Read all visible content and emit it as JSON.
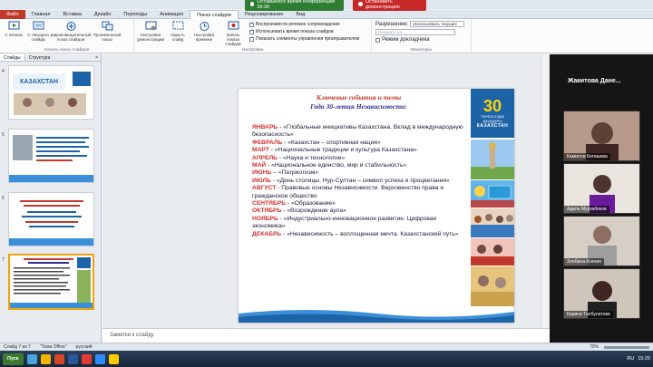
{
  "conference": {
    "time_label": "Оставшееся время конференции: 36:36",
    "stop_label": "Остановить демонстрацию"
  },
  "tabs": [
    "Файл",
    "Главная",
    "Вставка",
    "Дизайн",
    "Переходы",
    "Анимация",
    "Показ слайдов",
    "Рецензирование",
    "Вид"
  ],
  "ribbon": {
    "group1": {
      "label": "Начать показ слайдов",
      "buttons": [
        "С начала",
        "С текущего слайда",
        "Широковещательный показ слайдов",
        "Произвольный показ"
      ]
    },
    "group2": {
      "label": "Настройка",
      "buttons": [
        "Настройка демонстрации",
        "Скрыть слайд",
        "Настройка времени",
        "Запись показа слайдов"
      ],
      "checkboxes": [
        "Воспроизвести речевое сопровождение",
        "Использовать время показа слайдов",
        "Показать элементы управления проигрывателем"
      ]
    },
    "group3": {
      "label": "Мониторы",
      "resolution_label": "Разрешение:",
      "resolution_value": "Использовать текущее",
      "show_on_label": "Показать на:",
      "presenter_label": "Режим докладчика"
    }
  },
  "left_panel": {
    "tabs": [
      "Слайды",
      "Структура"
    ],
    "close": "×",
    "slide_numbers": [
      "4",
      "5",
      "6",
      "7"
    ]
  },
  "slide": {
    "title_line1": "Ключевые события и темы",
    "title_line2": "Года 30-летия Независимости:",
    "logo_number": "30",
    "logo_text": "ТӘУЕЛСІЗДІК ЖЫЛДАРЫ",
    "logo_brand": "КАЗАХСТАН",
    "events": [
      {
        "month": "ЯНВАРЬ",
        "text": " - «Глобальные инициативы Казахстана. Вклад в международную безопасность»"
      },
      {
        "month": "ФЕВРАЛЬ",
        "text": " - «Казахстан – спортивная нация»"
      },
      {
        "month": "МАРТ",
        "text": " - «Национальные традиции и культура Казахстана»"
      },
      {
        "month": "АПРЕЛЬ",
        "text": " - «Наука и технологии»"
      },
      {
        "month": "МАЙ",
        "text": " - «Национальное единство, мир и стабильность»"
      },
      {
        "month": "ИЮНЬ",
        "text": " – «Патриотизм»"
      },
      {
        "month": "ИЮЛЬ",
        "text": " - «День столицы. Нур-Султан – символ успеха и процветания»"
      },
      {
        "month": "АВГУСТ",
        "text": " - Правовые основы Независимости. Верховенство права и гражданское общество"
      },
      {
        "month": "СЕНТЯБРЬ",
        "text": " - «Образование»"
      },
      {
        "month": "ОКТЯБРЬ",
        "text": " - «Возрождение аула»"
      },
      {
        "month": "НОЯБРЬ",
        "text": " - «Индустриально-инновационное развитие. Цифровая экономика»"
      },
      {
        "month": "ДЕКАБРЬ",
        "text": " - «Независимость – воплощенная мечта. Казахстанский путь»"
      }
    ]
  },
  "notes": {
    "placeholder": "Заметки к слайду"
  },
  "video": {
    "header": "Жакитова Дане...",
    "participants": [
      "Камилла Бегишева",
      "Адиль Мурзабеков",
      "Злобина Ксения",
      "Карина Таобулатова"
    ]
  },
  "status": {
    "slide": "Слайд 7 из 7",
    "theme": "\"Тема Office\"",
    "lang": "русский",
    "zoom": "70%"
  },
  "taskbar": {
    "start": "Пуск",
    "lang": "RU",
    "time": "15:25"
  },
  "colors": {
    "accent": "#c0392b",
    "month": "#d32f2f",
    "logo_bg": "#1d63a8",
    "logo_num": "#ffd700"
  }
}
